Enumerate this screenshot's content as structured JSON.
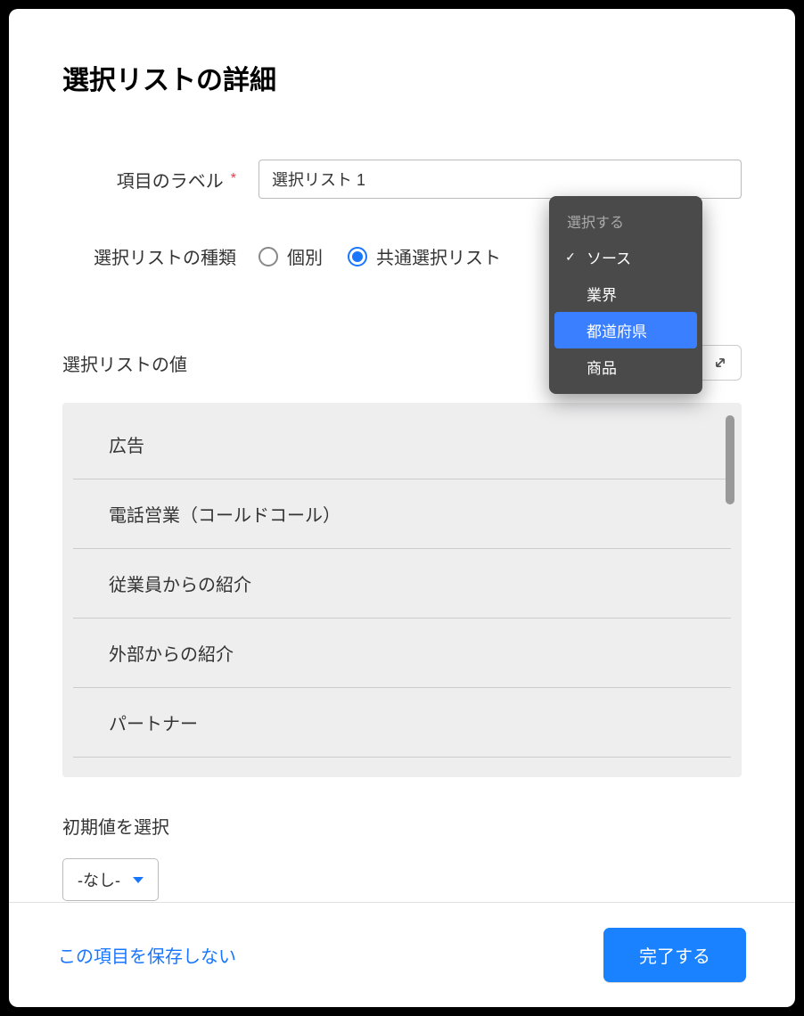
{
  "title": "選択リストの詳細",
  "form": {
    "label_field": {
      "label": "項目のラベル",
      "required_mark": "*",
      "value": "選択リスト 1"
    },
    "type_field": {
      "label": "選択リストの種類",
      "option_individual": "個別",
      "option_common": "共通選択リスト",
      "selected": "common"
    }
  },
  "dropdown": {
    "header": "選択する",
    "items": [
      {
        "label": "ソース",
        "checked": true,
        "highlighted": false
      },
      {
        "label": "業界",
        "checked": false,
        "highlighted": false
      },
      {
        "label": "都道府県",
        "checked": false,
        "highlighted": true
      },
      {
        "label": "商品",
        "checked": false,
        "highlighted": false
      }
    ]
  },
  "values_section": {
    "title": "選択リストの値",
    "items": [
      "広告",
      "電話営業（コールドコール）",
      "従業員からの紹介",
      "外部からの紹介",
      "パートナー"
    ]
  },
  "default_section": {
    "label": "初期値を選択",
    "value": "-なし-"
  },
  "footer": {
    "discard": "この項目を保存しない",
    "done": "完了する"
  }
}
